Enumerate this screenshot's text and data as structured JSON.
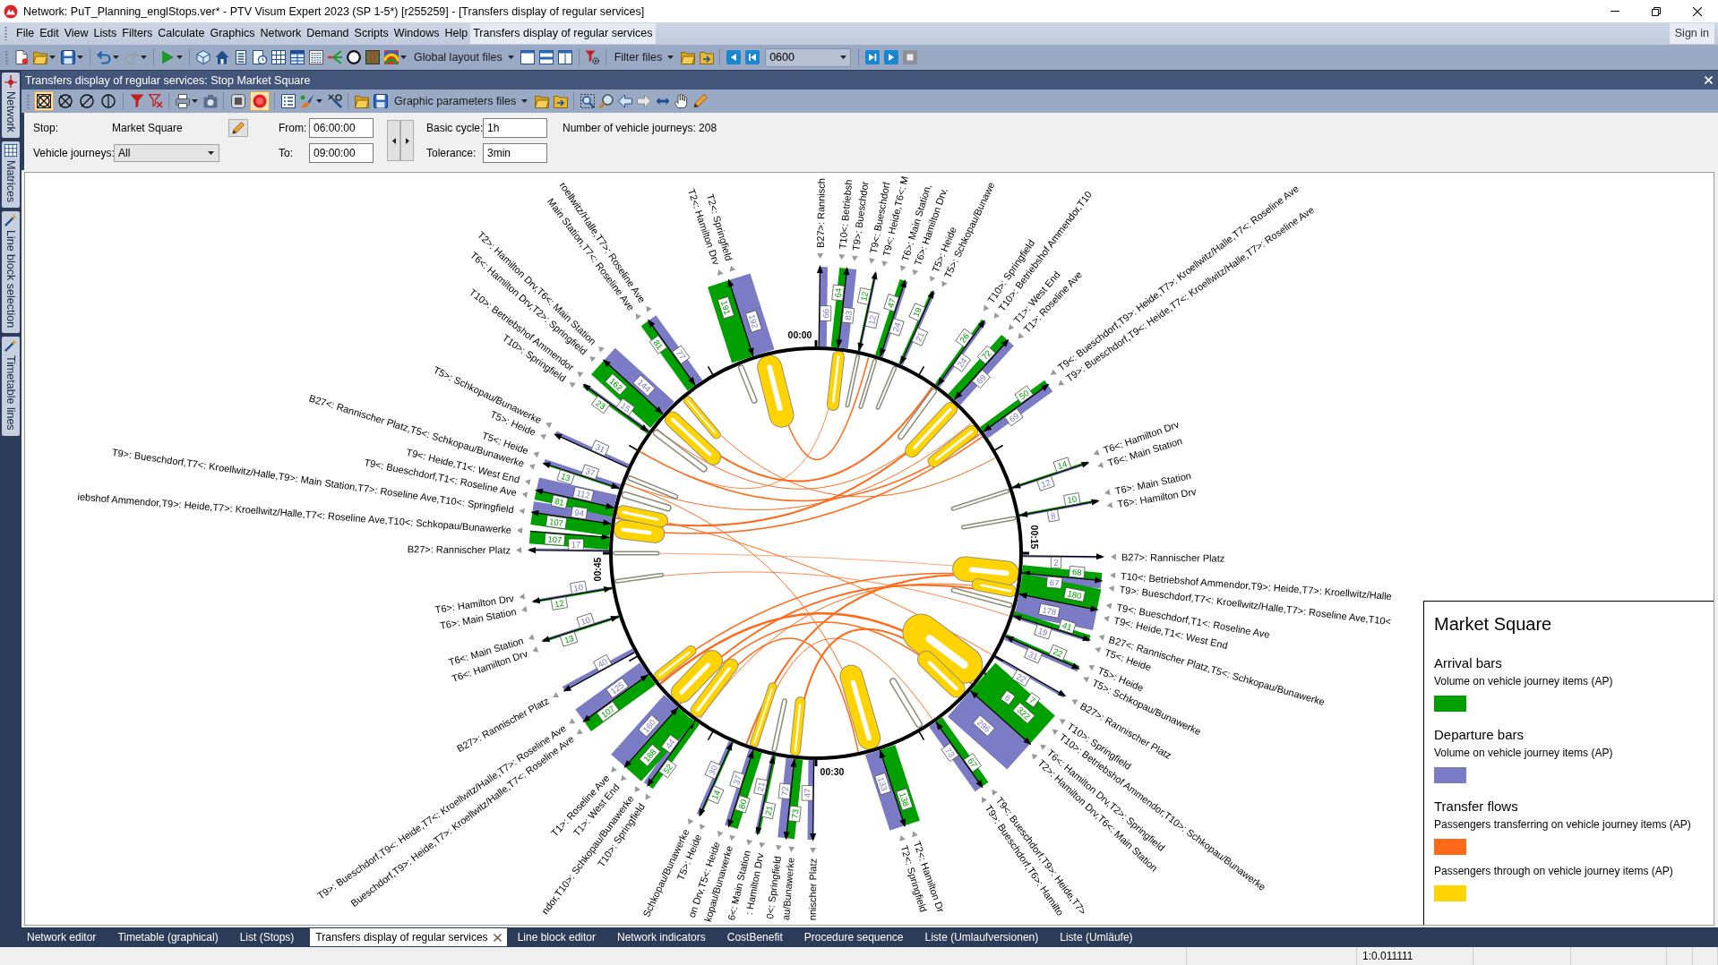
{
  "window": {
    "title": "Network: PuT_Planning_englStops.ver* - PTV Visum Expert 2023 (SP 1-5*) [r255259] - [Transfers display of regular services]"
  },
  "menu": {
    "items": [
      {
        "label": "File",
        "selected": false
      },
      {
        "label": "Edit",
        "selected": false
      },
      {
        "label": "View",
        "selected": false
      },
      {
        "label": "Lists",
        "selected": false
      },
      {
        "label": "Filters",
        "selected": false
      },
      {
        "label": "Calculate",
        "selected": false
      },
      {
        "label": "Graphics",
        "selected": false
      },
      {
        "label": "Network",
        "selected": false
      },
      {
        "label": "Demand",
        "selected": false
      },
      {
        "label": "Scripts",
        "selected": false
      },
      {
        "label": "Windows",
        "selected": false
      },
      {
        "label": "Help",
        "selected": false
      },
      {
        "label": "Transfers display of regular services",
        "selected": true
      }
    ],
    "sign_in": "Sign in"
  },
  "toolbar": {
    "layout_files": "Global layout files",
    "filter_files": "Filter files",
    "time_field": "0600"
  },
  "side_tabs": [
    {
      "label": "Network"
    },
    {
      "label": "Matrices"
    },
    {
      "label": "Line block selection"
    },
    {
      "label": "Timetable lines"
    }
  ],
  "document": {
    "title": "Transfers display of regular services: Stop Market Square",
    "toolbar": {
      "view_buttons": [
        {
          "selected": true
        },
        {
          "selected": false
        },
        {
          "selected": false
        },
        {
          "selected": false
        }
      ],
      "toggle_buttons": [
        {
          "on": false
        },
        {
          "on": true
        }
      ],
      "parameter_files": "Graphic parameters files"
    },
    "parameters": {
      "stop_label": "Stop:",
      "stop": "Market Square",
      "from_label": "From:",
      "from": "06:00:00",
      "to_label": "To:",
      "to": "09:00:00",
      "cycle_label": "Basic cycle:",
      "cycle": "1h",
      "tolerance_label": "Tolerance:",
      "tolerance": "3min",
      "journeys_count": "Number of vehicle journeys: 208",
      "journeys_label": "Vehicle journeys:",
      "journeys": "All"
    }
  },
  "diagram": {
    "time_marks": [
      "00:00",
      "00:15",
      "00:30",
      "00:45"
    ],
    "spokes": [
      {
        "labels": [
          "B27>: Rannisch"
        ],
        "departure": "66"
      },
      {
        "labels": [
          "T10<: Betriebsh",
          "T9>: Bueschdor"
        ],
        "arrival": "64",
        "departure": "83"
      },
      {
        "labels": [
          "T9<: Bueschdorf",
          "T9<: Heide,T6<: M"
        ],
        "arrival": "12",
        "departure": "12"
      },
      {
        "labels": [
          "T6>: Main Station,",
          "T6>: Hamilton Drv,"
        ],
        "arrival": "47",
        "departure": "24"
      },
      {
        "labels": [
          "T5>: Heide",
          "T5>: Schkopau/Bunawe"
        ],
        "arrival": "19",
        "departure": "21"
      },
      {
        "labels": [
          "T10>: Springfield",
          "T10>: Betriebshof Ammendor,T10"
        ],
        "arrival": "26",
        "departure": "24"
      },
      {
        "labels": [
          "T1>: West End",
          "T1>: Roseline Ave"
        ],
        "arrival": "72",
        "departure": "69"
      },
      {
        "labels": [
          "T9<: Bueschdorf,T9>: Heide,T7>: Kroellwitz/Halle,T7<: Roseline Ave",
          "T9>: Bueschdorf,T9<: Heide,T7<: Kroellwitz/Halle,T7>: Roseline Ave"
        ],
        "arrival": "50",
        "departure": "69"
      },
      {
        "labels": [
          "T6<: Hamilton Drv",
          "T6<: Main Station"
        ],
        "arrival": "14",
        "departure": "12"
      },
      {
        "labels": [
          "T6>: Main Station",
          "T6>: Hamilton Drv"
        ],
        "arrival": "10",
        "departure": "8"
      },
      {
        "labels": [
          "B27>: Rannischer Platz"
        ],
        "departure": "2"
      },
      {
        "labels": [
          "T10<: Betriebshof Ammendor,T9>: Heide,T7>: Kroellwitz/Halle",
          "T9>: Bueschdorf,T7<: Kroellwitz/Halle,T7>: Roseline Ave,T10<"
        ],
        "arrival": "68",
        "departure": "67"
      },
      {
        "labels": [
          "T9<: Bueschdorf,T1<: Roseline Ave",
          "T9<: Heide,T1<: West End"
        ],
        "arrival": "180",
        "departure": "178"
      },
      {
        "labels": [
          "B27<: Rannischer Platz,T5<: Schkopau/Bunawerke",
          "T5<: Heide"
        ],
        "arrival": "41",
        "departure": "19"
      },
      {
        "labels": [
          "T5>: Heide",
          "T5>: Schkopau/Bunawerke"
        ],
        "arrival": "22",
        "departure": "31"
      },
      {
        "labels": [
          "B27>: Rannischer Platz"
        ],
        "departure": "22"
      },
      {
        "labels": [
          "T10>: Springfield",
          "T10>: Betriebshof Ammendor,T10>: Schkopau/Bunawerke"
        ],
        "arrival": "7",
        "departure": "6"
      },
      {
        "labels": [
          "T6<: Hamilton Drv,T2>: Springfield",
          "T2>: Hamilton Drv,T6<: Main Station"
        ],
        "arrival": "322",
        "departure": "296"
      },
      {
        "labels": [
          "T9<: Bueschdorf,T9>: Heide,T7>",
          "T9>: Bueschdorf,T6>: Hamilto"
        ],
        "arrival": "67",
        "departure": "73"
      },
      {
        "labels": [
          "T2<: Hamilton Dr",
          "T2<: Springfield"
        ],
        "arrival": "138",
        "departure": "133"
      },
      {
        "labels": [
          "nnischer Platz"
        ],
        "departure": "47"
      },
      {
        "labels": [
          "au/Bunawerke",
          "0<: Springfield"
        ],
        "arrival": "73",
        "departure": "72"
      },
      {
        "labels": [
          ": Hamilton Drv",
          "6<: Main Station"
        ],
        "arrival": "21",
        "departure": "21"
      },
      {
        "labels": [
          "kopau/Bunawerke",
          "on Drv,T5<: Heide"
        ],
        "arrival": "80",
        "departure": "37"
      },
      {
        "labels": [
          "T5>: Heide",
          "Schkopau/Bunawerke"
        ],
        "arrival": "14",
        "departure": "30"
      },
      {
        "labels": [
          "T10>: Springfield",
          "ndor,T10>: Schkopau/Bunawerke"
        ],
        "arrival": "52",
        "departure": "44"
      },
      {
        "labels": [
          "T1>: West End",
          "T1>: Roseline Ave"
        ],
        "arrival": "188",
        "departure": "160"
      },
      {
        "labels": [
          "Bueschdorf,T9>: Heide,T7>: Kroellwitz/Halle,T7<: Roseline Ave",
          "T9>: Bueschdorf,T9<: Heide,T7<: Kroellwitz/Halle,T7>: Roseline Ave"
        ],
        "arrival": "107",
        "departure": "125"
      },
      {
        "labels": [
          "B27>: Rannischer Platz"
        ],
        "departure": "40"
      },
      {
        "labels": [
          "T6<: Hamilton Drv",
          "T6<: Main Station"
        ],
        "arrival": "13",
        "departure": "10"
      },
      {
        "labels": [
          "T6>: Main Station",
          "T6>: Hamilton Drv"
        ],
        "arrival": "12",
        "departure": "10"
      },
      {
        "labels": [
          "B27>: Rannischer Platz"
        ],
        "departure": "17"
      },
      {
        "labels": [
          "iebshof Ammendor,T9>: Heide,T7>: Kroellwitz/Halle,T7<: Roseline Ave,T10<: Schkopau/Bunawerke"
        ],
        "arrival": "107"
      },
      {
        "labels": [
          "T9>: Bueschdorf,T7<: Kroellwitz/Halle,T9>: Main Station,T7>: Roseline Ave,T10<: Springfield"
        ],
        "arrival": "107",
        "departure": "94"
      },
      {
        "labels": [
          "T9<: Bueschdorf,T1<: Roseline Ave",
          "T9<: Heide,T1<: West End"
        ],
        "arrival": "81",
        "departure": "112"
      },
      {
        "labels": [
          "B27<: Rannischer Platz,T5<: Schkopau/Bunawerke",
          "T5<: Heide"
        ],
        "arrival": "13",
        "departure": "37"
      },
      {
        "labels": [
          "T5>: Heide",
          "T5>: Schkopau/Bunawerke"
        ],
        "departure": "31"
      },
      {
        "labels": [
          "T10>: Springfield",
          "T10>: Betriebshof Ammendor"
        ],
        "arrival": "23",
        "departure": "15"
      },
      {
        "labels": [
          "T6<: Hamilton Drv,T2>: Springfield",
          "T2>: Hamilton Drv,T6<: Main Station"
        ],
        "arrival": "162",
        "departure": "144"
      },
      {
        "labels": [
          "Main Station,T7<: Roseline Ave",
          "roellwitz/Halle,T7>: Roseline Ave"
        ],
        "arrival": "81",
        "departure": "77"
      },
      {
        "labels": [
          "T2<: Hamilton Drv",
          "T2<: Springfield"
        ],
        "arrival": "191",
        "departure": "192"
      }
    ]
  },
  "legend": {
    "title": "Market Square",
    "sections": [
      {
        "heading": "Arrival bars",
        "items": [
          {
            "label": "Volume on vehicle journey items (AP)",
            "color": "#00a000"
          }
        ]
      },
      {
        "heading": "Departure bars",
        "items": [
          {
            "label": "Volume on vehicle journey items (AP)",
            "color": "#7b7bc6"
          }
        ]
      },
      {
        "heading": "Transfer flows",
        "items": [
          {
            "label": "Passengers transferring on vehicle journey items (AP)",
            "color": "#ff6a1a"
          },
          {
            "label": "Passengers through on vehicle journey items (AP)",
            "color": "#ffd400"
          }
        ]
      }
    ]
  },
  "bottom_tabs": [
    {
      "label": "Network editor",
      "selected": false
    },
    {
      "label": "Timetable (graphical)",
      "selected": false
    },
    {
      "label": "List (Stops)",
      "selected": false
    },
    {
      "label": "Transfers display of regular services",
      "selected": true
    },
    {
      "label": "Line block editor",
      "selected": false
    },
    {
      "label": "Network indicators",
      "selected": false
    },
    {
      "label": "CostBenefit",
      "selected": false
    },
    {
      "label": "Procedure sequence",
      "selected": false
    },
    {
      "label": "Liste (Umlaufversionen)",
      "selected": false
    },
    {
      "label": "Liste (Umläufe)",
      "selected": false
    }
  ],
  "status_bar": {
    "scale": "1:0.011111"
  }
}
